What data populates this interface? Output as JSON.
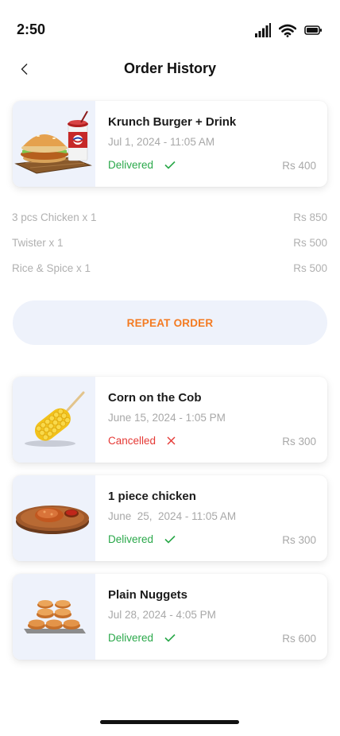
{
  "status_bar": {
    "time": "2:50"
  },
  "header": {
    "title": "Order History"
  },
  "expanded_order": {
    "name": "Krunch Burger + Drink",
    "date": "Jul 1, 2024 - 11:05 AM",
    "status": "Delivered",
    "price": "Rs 400",
    "thumbnail": "burger-with-drink",
    "items": [
      {
        "label": "3 pcs Chicken x 1",
        "price": "Rs 850"
      },
      {
        "label": "Twister x 1",
        "price": "Rs 500"
      },
      {
        "label": "Rice & Spice x 1",
        "price": "Rs 500"
      }
    ],
    "repeat_label": "REPEAT ORDER"
  },
  "orders": [
    {
      "name": "Corn on the Cob",
      "date": "June 15, 2024 - 1:05 PM",
      "status": "Cancelled",
      "price": "Rs 300",
      "thumbnail": "corn-cob"
    },
    {
      "name": "1 piece chicken",
      "date": "June  25,  2024 - 11:05 AM",
      "status": "Delivered",
      "price": "Rs 300",
      "thumbnail": "chicken-platter"
    },
    {
      "name": "Plain Nuggets",
      "date": "Jul 28, 2024 - 4:05 PM",
      "status": "Delivered",
      "price": "Rs 600",
      "thumbnail": "nuggets"
    }
  ],
  "colors": {
    "delivered": "#2aa84a",
    "cancelled": "#e53935",
    "accent": "#f47a20",
    "thumb_bg": "#eef2fb"
  }
}
